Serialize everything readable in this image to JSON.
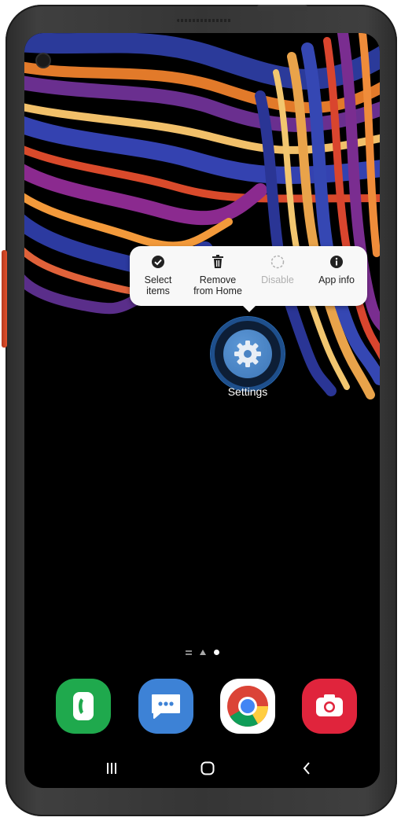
{
  "popup_menu": {
    "items": [
      {
        "label": "Select\nitems",
        "icon": "check-circle-icon",
        "enabled": true
      },
      {
        "label": "Remove\nfrom Home",
        "icon": "trash-icon",
        "enabled": true
      },
      {
        "label": "Disable",
        "icon": "dashed-circle-icon",
        "enabled": false
      },
      {
        "label": "App info",
        "icon": "info-icon",
        "enabled": true
      }
    ]
  },
  "home": {
    "settings_label": "Settings"
  },
  "dock": {
    "apps": [
      "phone-app",
      "messages-app",
      "chrome-app",
      "camera-app"
    ]
  },
  "navbar": {
    "buttons": [
      "recents",
      "home",
      "back"
    ]
  },
  "colors": {
    "popup_bg": "#f8f8f8",
    "settings_blue": "#3e77b8",
    "phone_green": "#1fa94d",
    "messages_blue": "#3d82d6",
    "camera_red": "#e0243c"
  }
}
